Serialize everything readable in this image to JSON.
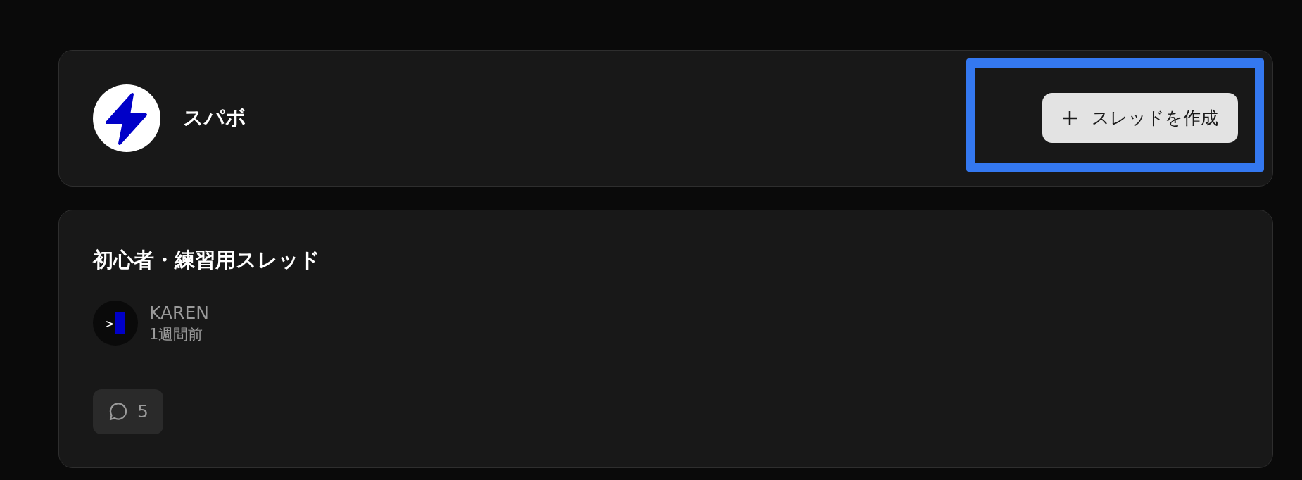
{
  "community": {
    "name": "スパボ",
    "create_button": {
      "label": "スレッドを作成",
      "highlighted": true
    }
  },
  "threads": [
    {
      "title": "初心者・練習用スレッド",
      "author": {
        "avatar_glyph": ">",
        "name": "KAREN"
      },
      "time": "1週間前",
      "comment_count": "5"
    }
  ]
}
